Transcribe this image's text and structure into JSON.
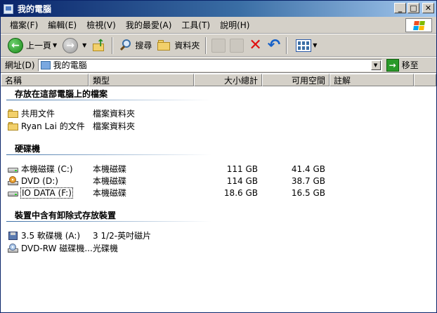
{
  "window": {
    "title": "我的電腦",
    "controls": {
      "minimize": "_",
      "maximize": "□",
      "close": "✕"
    }
  },
  "menu": [
    "檔案(F)",
    "編輯(E)",
    "檢視(V)",
    "我的最愛(A)",
    "工具(T)",
    "說明(H)"
  ],
  "toolbar": {
    "back_label": "上一頁",
    "search_label": "搜尋",
    "folders_label": "資料夾"
  },
  "address": {
    "label": "網址(D)",
    "value": "我的電腦",
    "go_label": "移至"
  },
  "columns": [
    "名稱",
    "類型",
    "大小總計",
    "可用空間",
    "註解"
  ],
  "groups": [
    {
      "title": "存放在這部電腦上的檔案",
      "items": [
        {
          "name": "共用文件",
          "type": "檔案資料夾",
          "size": "",
          "free": "",
          "icon": "folder-icon"
        },
        {
          "name": "Ryan Lai 的文件",
          "type": "檔案資料夾",
          "size": "",
          "free": "",
          "icon": "folder-icon"
        }
      ]
    },
    {
      "title": "硬碟機",
      "items": [
        {
          "name": "本機磁碟 (C:)",
          "type": "本機磁碟",
          "size": "111 GB",
          "free": "41.4 GB",
          "icon": "hard-disk-icon"
        },
        {
          "name": "DVD (D:)",
          "type": "本機磁碟",
          "size": "114 GB",
          "free": "38.7 GB",
          "icon": "dvd-drive-icon"
        },
        {
          "name": "IO DATA (F:)",
          "type": "本機磁碟",
          "size": "18.6 GB",
          "free": "16.5 GB",
          "icon": "hard-disk-icon"
        }
      ]
    },
    {
      "title": "裝置中含有卸除式存放裝置",
      "items": [
        {
          "name": "3.5 軟碟機 (A:)",
          "type": "3 1/2-英吋磁片",
          "size": "",
          "free": "",
          "icon": "floppy-drive-icon"
        },
        {
          "name": "DVD-RW 磁碟機...",
          "type": "光碟機",
          "size": "",
          "free": "",
          "icon": "cd-rw-drive-icon"
        }
      ]
    }
  ],
  "colors": {
    "title_gradient_start": "#0a246a",
    "title_gradient_end": "#a6caf0",
    "chrome": "#d4d0c8",
    "group_line": "#3a6ea5"
  }
}
